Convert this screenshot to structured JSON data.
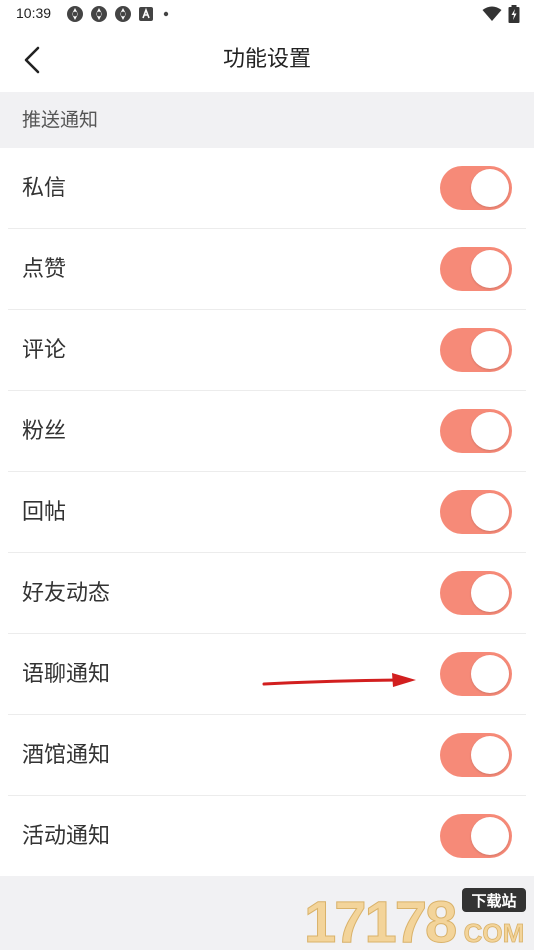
{
  "status_bar": {
    "time": "10:39",
    "left_icons": [
      "app-notification-icon",
      "app-notification-icon",
      "app-notification-icon",
      "a-badge-icon",
      "dot-icon"
    ],
    "right_icons": [
      "wifi-icon",
      "battery-charging-icon"
    ]
  },
  "header": {
    "title": "功能设置",
    "back_icon": "chevron-left-icon"
  },
  "section": {
    "title": "推送通知"
  },
  "settings": [
    {
      "label": "私信",
      "enabled": true
    },
    {
      "label": "点赞",
      "enabled": true
    },
    {
      "label": "评论",
      "enabled": true
    },
    {
      "label": "粉丝",
      "enabled": true
    },
    {
      "label": "回帖",
      "enabled": true
    },
    {
      "label": "好友动态",
      "enabled": true
    },
    {
      "label": "语聊通知",
      "enabled": true
    },
    {
      "label": "酒馆通知",
      "enabled": true
    },
    {
      "label": "活动通知",
      "enabled": true
    }
  ],
  "colors": {
    "toggle_on": "#f68a78",
    "section_bg": "#f1f1f3",
    "annotation_arrow": "#d21f1f"
  },
  "watermark": {
    "number": "17178",
    "tag": "下载站",
    "suffix": "COM"
  }
}
